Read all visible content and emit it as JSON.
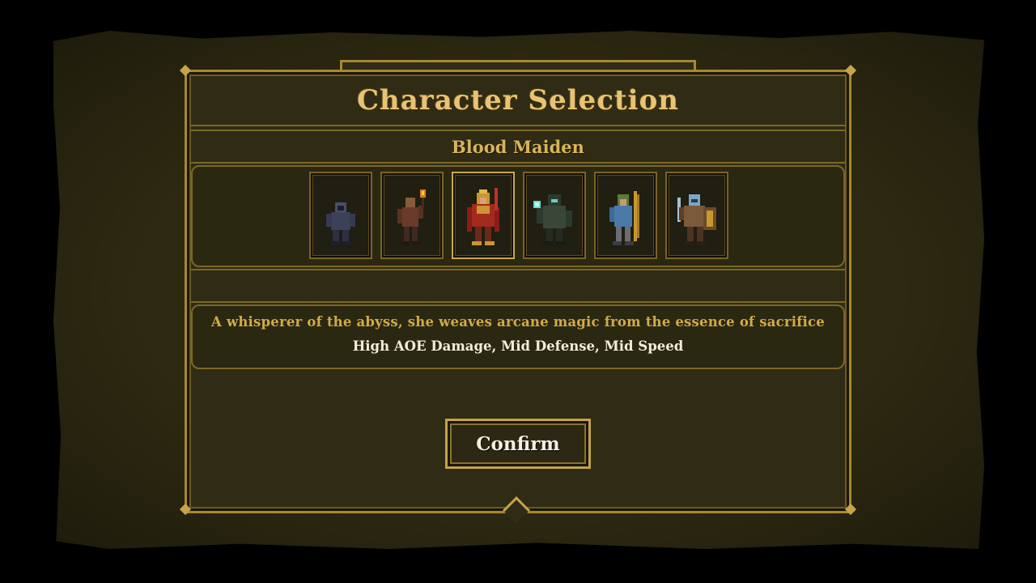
{
  "screen": {
    "title": "Character Selection",
    "selected_name": "Blood Maiden",
    "description": "A whisperer of the abyss, she weaves arcane magic from the essence of sacrifice",
    "stats": "High AOE Damage, Mid Defense, Mid Speed",
    "confirm_label": "Confirm"
  },
  "characters": [
    {
      "icon": "hooded-rogue-portrait",
      "selected": false
    },
    {
      "icon": "torch-bearer-portrait",
      "selected": false
    },
    {
      "icon": "blood-maiden-portrait",
      "selected": true
    },
    {
      "icon": "dark-mage-portrait",
      "selected": false
    },
    {
      "icon": "archer-portrait",
      "selected": false
    },
    {
      "icon": "shield-knight-portrait",
      "selected": false
    }
  ],
  "colors": {
    "gold": "#c7a44a",
    "title": "#e7c373",
    "panel": "#2f2b14"
  }
}
